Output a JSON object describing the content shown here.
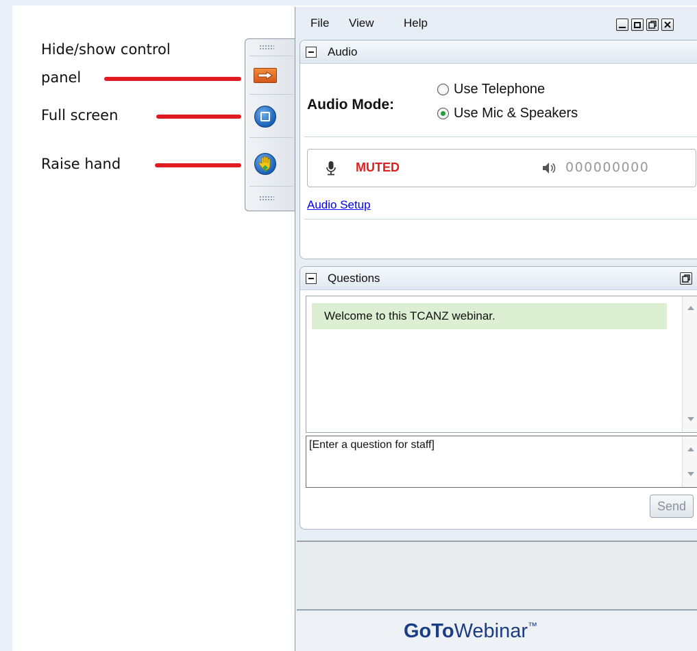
{
  "annotations": {
    "hide_show_line1": "Hide/show control",
    "hide_show_line2": "panel",
    "full_screen": "Full screen",
    "raise_hand": "Raise hand"
  },
  "menu": {
    "file": "File",
    "view": "View",
    "help": "Help"
  },
  "audio": {
    "title": "Audio",
    "mode_label": "Audio Mode:",
    "option_telephone": "Use Telephone",
    "option_mic": "Use Mic & Speakers",
    "selected": "Use Mic & Speakers",
    "mic_status": "MUTED",
    "speaker_level": "000000000",
    "setup_link": "Audio Setup"
  },
  "questions": {
    "title": "Questions",
    "messages": [
      "Welcome to this TCANZ webinar."
    ],
    "input_placeholder": "[Enter a question for staff]",
    "send_label": "Send"
  },
  "brand": {
    "goto": "GoTo",
    "webinar": "Webinar",
    "tm": "™"
  },
  "colors": {
    "muted": "#e02020",
    "link": "#0000ee",
    "accent_orange": "#e8731f",
    "message_bg": "#dcefd3",
    "red_pointer": "#e01b22"
  }
}
